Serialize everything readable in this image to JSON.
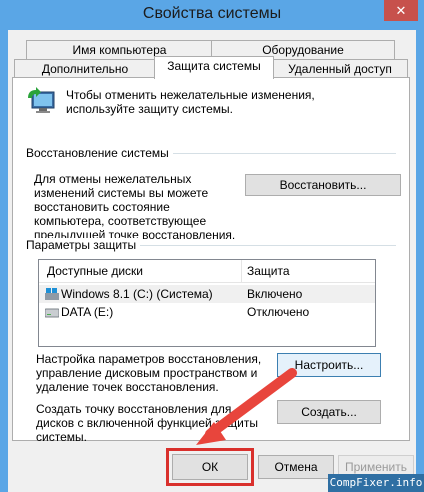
{
  "window": {
    "title": "Свойства системы",
    "close_glyph": "✕"
  },
  "tabs": {
    "row1": [
      "Имя компьютера",
      "Оборудование"
    ],
    "row2": [
      "Дополнительно",
      "Защита системы",
      "Удаленный доступ"
    ],
    "active": "Защита системы"
  },
  "info": {
    "text": "Чтобы отменить нежелательные изменения, используйте защиту системы."
  },
  "restore": {
    "heading": "Восстановление системы",
    "text": "Для отмены нежелательных изменений системы вы можете восстановить состояние компьютера, соответствующее предыдущей точке восстановления.",
    "button": "Восстановить..."
  },
  "protection": {
    "heading": "Параметры защиты",
    "columns": [
      "Доступные диски",
      "Защита"
    ],
    "rows": [
      {
        "disk": "Windows 8.1 (C:) (Система)",
        "status": "Включено",
        "icon": "system-drive-icon"
      },
      {
        "disk": "DATA (E:)",
        "status": "Отключено",
        "icon": "drive-icon"
      }
    ],
    "configure_text": "Настройка параметров восстановления, управление дисковым пространством и удаление точек восстановления.",
    "configure_button": "Настроить...",
    "create_text": "Создать точку восстановления для дисков с включенной функцией защиты системы.",
    "create_button": "Создать..."
  },
  "footer": {
    "ok": "ОК",
    "cancel": "Отмена",
    "apply": "Применить"
  },
  "watermark": "CompFixer.info",
  "colors": {
    "frame": "#5aa6e6",
    "close": "#c7514c",
    "highlight": "#d9302c",
    "arrow": "#e8453c"
  }
}
